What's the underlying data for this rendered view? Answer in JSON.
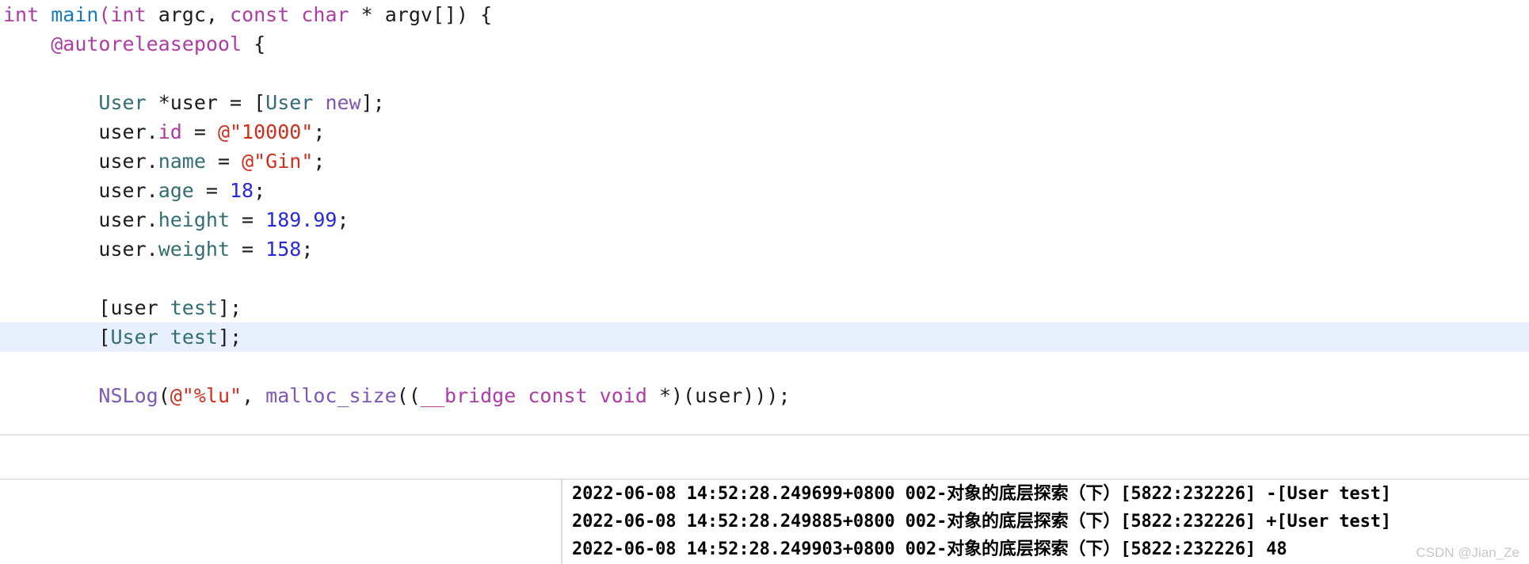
{
  "editor": {
    "language": "objective-c",
    "highlight_color": "#e8f0fd",
    "lines": [
      {
        "indent": 0,
        "highlighted": false,
        "tokens": [
          {
            "t": "int",
            "c": "kw"
          },
          {
            "t": " ",
            "c": "plain"
          },
          {
            "t": "main",
            "c": "fn"
          },
          {
            "t": "(",
            "c": "kw"
          },
          {
            "t": "int",
            "c": "kw"
          },
          {
            "t": " argc, ",
            "c": "plain"
          },
          {
            "t": "const",
            "c": "kw"
          },
          {
            "t": " ",
            "c": "plain"
          },
          {
            "t": "char",
            "c": "kw"
          },
          {
            "t": " * argv[]) {",
            "c": "plain"
          }
        ]
      },
      {
        "indent": 1,
        "highlighted": false,
        "tokens": [
          {
            "t": "@autoreleasepool",
            "c": "atkw"
          },
          {
            "t": " {",
            "c": "plain"
          }
        ]
      },
      {
        "indent": 0,
        "highlighted": false,
        "blank": true,
        "tokens": []
      },
      {
        "indent": 2,
        "highlighted": false,
        "tokens": [
          {
            "t": "User",
            "c": "type"
          },
          {
            "t": " *user = [",
            "c": "plain"
          },
          {
            "t": "User",
            "c": "type"
          },
          {
            "t": " ",
            "c": "plain"
          },
          {
            "t": "new",
            "c": "meth"
          },
          {
            "t": "];",
            "c": "plain"
          }
        ]
      },
      {
        "indent": 2,
        "highlighted": false,
        "tokens": [
          {
            "t": "user.",
            "c": "plain"
          },
          {
            "t": "id",
            "c": "kw"
          },
          {
            "t": " = ",
            "c": "plain"
          },
          {
            "t": "@\"10000\"",
            "c": "str"
          },
          {
            "t": ";",
            "c": "plain"
          }
        ]
      },
      {
        "indent": 2,
        "highlighted": false,
        "tokens": [
          {
            "t": "user.",
            "c": "plain"
          },
          {
            "t": "name",
            "c": "type"
          },
          {
            "t": " = ",
            "c": "plain"
          },
          {
            "t": "@\"Gin\"",
            "c": "str"
          },
          {
            "t": ";",
            "c": "plain"
          }
        ]
      },
      {
        "indent": 2,
        "highlighted": false,
        "tokens": [
          {
            "t": "user.",
            "c": "plain"
          },
          {
            "t": "age",
            "c": "type"
          },
          {
            "t": " = ",
            "c": "plain"
          },
          {
            "t": "18",
            "c": "num"
          },
          {
            "t": ";",
            "c": "plain"
          }
        ]
      },
      {
        "indent": 2,
        "highlighted": false,
        "tokens": [
          {
            "t": "user.",
            "c": "plain"
          },
          {
            "t": "height",
            "c": "type"
          },
          {
            "t": " = ",
            "c": "plain"
          },
          {
            "t": "189.99",
            "c": "num"
          },
          {
            "t": ";",
            "c": "plain"
          }
        ]
      },
      {
        "indent": 2,
        "highlighted": false,
        "tokens": [
          {
            "t": "user.",
            "c": "plain"
          },
          {
            "t": "weight",
            "c": "type"
          },
          {
            "t": " = ",
            "c": "plain"
          },
          {
            "t": "158",
            "c": "num"
          },
          {
            "t": ";",
            "c": "plain"
          }
        ]
      },
      {
        "indent": 0,
        "highlighted": false,
        "blank": true,
        "tokens": []
      },
      {
        "indent": 2,
        "highlighted": false,
        "tokens": [
          {
            "t": "[user ",
            "c": "plain"
          },
          {
            "t": "test",
            "c": "type"
          },
          {
            "t": "];",
            "c": "plain"
          }
        ]
      },
      {
        "indent": 2,
        "highlighted": true,
        "tokens": [
          {
            "t": "[",
            "c": "plain"
          },
          {
            "t": "User",
            "c": "type"
          },
          {
            "t": " ",
            "c": "plain"
          },
          {
            "t": "test",
            "c": "type"
          },
          {
            "t": "];",
            "c": "plain"
          }
        ]
      },
      {
        "indent": 0,
        "highlighted": false,
        "blank": true,
        "tokens": []
      },
      {
        "indent": 2,
        "highlighted": false,
        "tokens": [
          {
            "t": "NSLog",
            "c": "meth"
          },
          {
            "t": "(",
            "c": "plain"
          },
          {
            "t": "@\"%lu\"",
            "c": "str"
          },
          {
            "t": ", ",
            "c": "plain"
          },
          {
            "t": "malloc_size",
            "c": "meth"
          },
          {
            "t": "((",
            "c": "plain"
          },
          {
            "t": "__bridge",
            "c": "kw"
          },
          {
            "t": " ",
            "c": "plain"
          },
          {
            "t": "const",
            "c": "kw"
          },
          {
            "t": " ",
            "c": "plain"
          },
          {
            "t": "void",
            "c": "kw"
          },
          {
            "t": " *)(user)));",
            "c": "plain"
          }
        ]
      }
    ]
  },
  "console": {
    "lines": [
      "2022-06-08 14:52:28.249699+0800 002-对象的底层探索（下）[5822:232226] -[User test]",
      "2022-06-08 14:52:28.249885+0800 002-对象的底层探索（下）[5822:232226] +[User test]",
      "2022-06-08 14:52:28.249903+0800 002-对象的底层探索（下）[5822:232226] 48"
    ]
  },
  "watermark": {
    "text": "CSDN @Jian_Ze"
  }
}
